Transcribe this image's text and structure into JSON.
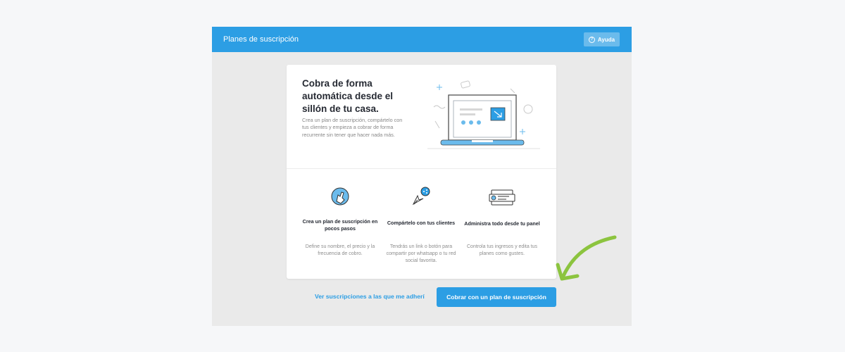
{
  "header": {
    "title": "Planes de suscripción",
    "help_label": "Ayuda"
  },
  "hero": {
    "title": "Cobra de forma automática desde el sillón de tu casa.",
    "description": "Crea un plan de suscripción, compártelo con tus clientes y empieza a cobrar de forma recurrente sin tener que hacer nada más."
  },
  "features": [
    {
      "title": "Crea un plan de suscripción en pocos pasos",
      "description": "Define su nombre, el precio y la frecuencia de cobro.",
      "icon": "hand-pointer-icon"
    },
    {
      "title": "Compártelo con tus clientes",
      "description": "Tendrás un link o botón para compartir por whatsapp o tu red social favorita.",
      "icon": "share-cursor-icon"
    },
    {
      "title": "Administra todo desde tu panel",
      "description": "Controla tus ingresos y edita tus planes como gustes.",
      "icon": "dashboard-panel-icon"
    }
  ],
  "actions": {
    "link_label": "Ver suscripciones a las que me adherí",
    "primary_label": "Cobrar con un plan de suscripción"
  },
  "colors": {
    "primary": "#2c9ee4",
    "annotation_arrow": "#8cc43f"
  }
}
